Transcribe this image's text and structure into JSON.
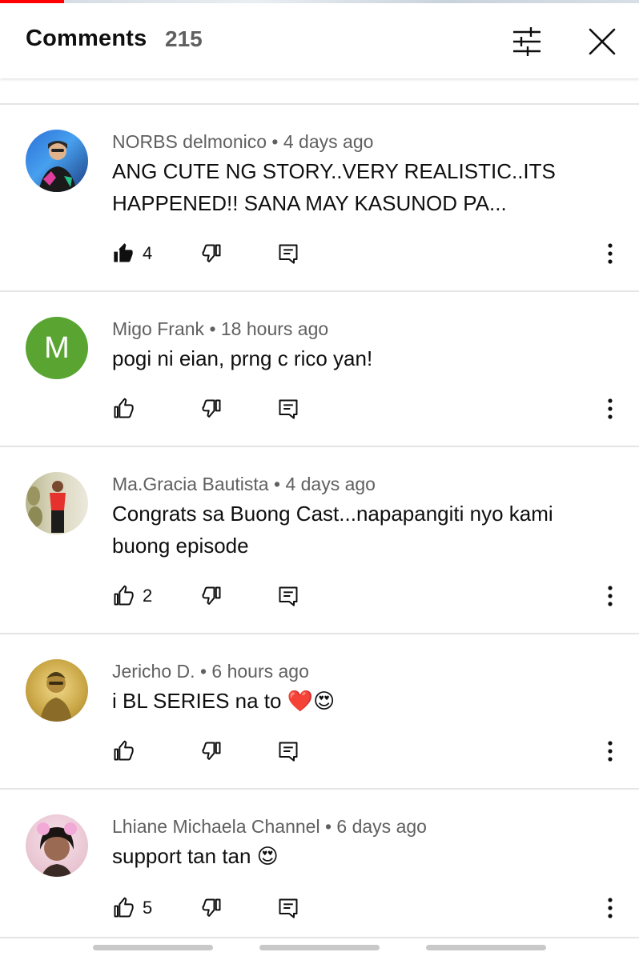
{
  "header": {
    "title": "Comments",
    "count": "215"
  },
  "comments": [
    {
      "author": "NORBS delmonico",
      "time": "4 days ago",
      "text": "ANG CUTE NG STORY..VERY REALISTIC..ITS HAPPENED!! SANA MAY KASUNOD PA...",
      "likes": "4",
      "liked": true,
      "avatar": "photo"
    },
    {
      "author": "Migo Frank",
      "time": "18 hours ago",
      "text": "pogi ni eian, prng c rico yan!",
      "likes": "",
      "liked": false,
      "avatar": "letter",
      "avatar_letter": "M",
      "avatar_color": "#5aa532"
    },
    {
      "author": "Ma.Gracia Bautista",
      "time": "4 days ago",
      "text": "Congrats sa Buong Cast...napapangiti nyo kami buong episode",
      "likes": "2",
      "liked": false,
      "avatar": "photo"
    },
    {
      "author": "Jericho D.",
      "time": "6 hours ago",
      "text": "i BL SERIES na to ❤️😍",
      "likes": "",
      "liked": false,
      "avatar": "photo"
    },
    {
      "author": "Lhiane Michaela Channel",
      "time": "6 days ago",
      "text": "support tan tan 😍",
      "likes": "5",
      "liked": false,
      "avatar": "photo"
    }
  ],
  "separator": "•",
  "icons": {
    "like": "thumb-up-icon",
    "dislike": "thumb-down-icon",
    "reply": "reply-icon",
    "more": "more-vertical-icon",
    "filter": "filter-sliders-icon",
    "close": "close-icon"
  },
  "colors": {
    "progress": "#ff0000",
    "meta_text": "#606060",
    "divider": "#e5e5e5"
  }
}
